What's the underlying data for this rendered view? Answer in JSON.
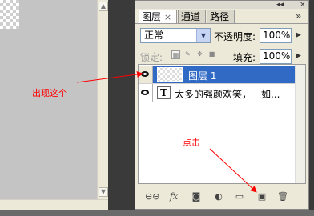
{
  "panel": {
    "tabs": [
      {
        "label": "图层",
        "close": "×"
      },
      {
        "label": "通道"
      },
      {
        "label": "路径"
      }
    ],
    "panel_controls": "»",
    "blend_mode": "正常",
    "opacity_label": "不透明度:",
    "opacity_value": "100%",
    "lock_label": "锁定:",
    "fill_label": "填充:",
    "fill_value": "100%",
    "layers": [
      {
        "name": "图层 1",
        "selected": true,
        "thumbnail": "transparent-checker"
      },
      {
        "name": "太多的强颜欢笑，一如...",
        "selected": false,
        "thumbnail": "text-layer-T"
      }
    ],
    "text_layer_icon": "T",
    "bottom_tools": [
      "link-icon",
      "fx-icon",
      "mask-icon",
      "adjustment-icon",
      "group-folder-icon",
      "new-layer-icon",
      "trash-icon"
    ],
    "bottom_tool_glyphs": {
      "fx": "fx"
    }
  },
  "annotations": {
    "left_note": "出现这个",
    "bottom_note": "点击",
    "color": "#ff0000"
  }
}
